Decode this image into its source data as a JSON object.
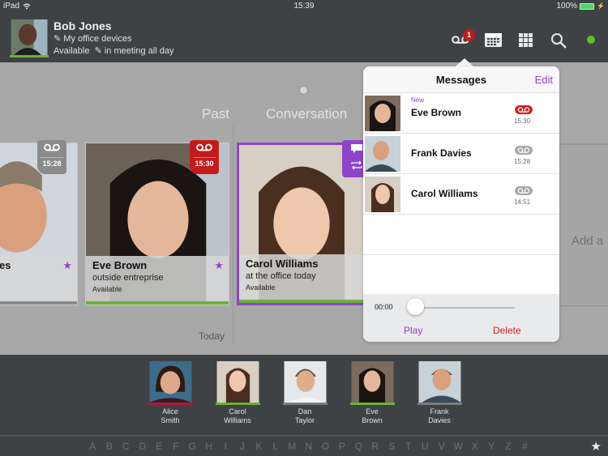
{
  "status_bar": {
    "device": "iPad",
    "time": "15:39",
    "battery": "100%"
  },
  "header": {
    "user_name": "Bob Jones",
    "devices_label": "My office devices",
    "presence": "Available",
    "status_message": "in meeting all day",
    "voicemail_badge": "1",
    "presence_color": "#5fbf2a"
  },
  "timeline": {
    "past_label": "Past",
    "conversation_label": "Conversation",
    "today_label": "Today",
    "add_label": "Add a"
  },
  "cards": [
    {
      "name": "Frank Davies",
      "name_visible": "es",
      "tag_time": "15:28",
      "tag_color": "#8a8a8a",
      "favorite": true
    },
    {
      "name": "Eve Brown",
      "note": "outside entreprise",
      "availability": "Available",
      "tag_time": "15:30",
      "tag_color": "#c21b1b",
      "favorite": true
    },
    {
      "name": "Carol Williams",
      "note": "at the office today",
      "availability": "Available",
      "tag_color": "#8e44c9"
    }
  ],
  "messages": {
    "title": "Messages",
    "edit_label": "Edit",
    "items": [
      {
        "new_label": "New",
        "name": "Eve Brown",
        "time": "15:30",
        "unread": true
      },
      {
        "name": "Frank Davies",
        "time": "15:28",
        "unread": false
      },
      {
        "name": "Carol Williams",
        "time": "14:51",
        "unread": false
      }
    ],
    "player": {
      "time": "00:00",
      "progress": 0,
      "play_label": "Play",
      "delete_label": "Delete"
    }
  },
  "favorites": [
    {
      "first": "Alice",
      "last": "Smith",
      "status_color": "#b0193a"
    },
    {
      "first": "Carol",
      "last": "Williams",
      "status_color": "#6ab23a"
    },
    {
      "first": "Dan",
      "last": "Taylor",
      "status_color": "#7b7b7b"
    },
    {
      "first": "Eve",
      "last": "Brown",
      "status_color": "#6ab23a"
    },
    {
      "first": "Frank",
      "last": "Davies",
      "status_color": "#7b7b7b"
    }
  ],
  "alphabet": [
    "A",
    "B",
    "C",
    "D",
    "E",
    "F",
    "G",
    "H",
    "I",
    "J",
    "K",
    "L",
    "M",
    "N",
    "O",
    "P",
    "Q",
    "R",
    "S",
    "T",
    "U",
    "V",
    "W",
    "X",
    "Y",
    "Z",
    "#"
  ],
  "colors": {
    "accent": "#8e44c9",
    "danger": "#c21b1b",
    "available": "#6ab23a"
  }
}
